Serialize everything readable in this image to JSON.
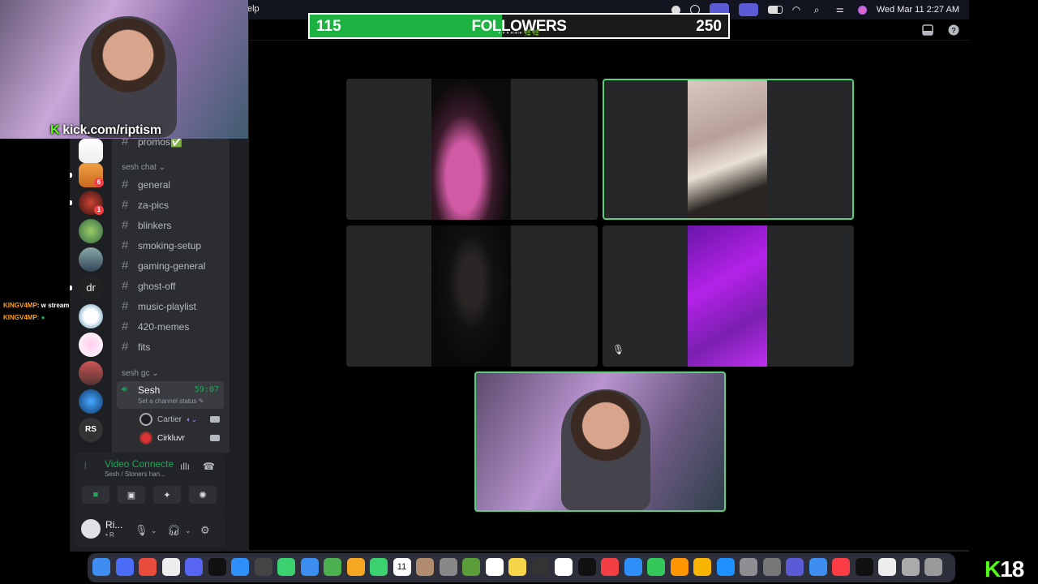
{
  "menubar": {
    "help": "elp",
    "datetime": "Wed Mar 11  2:27 AM"
  },
  "followers": {
    "current": "115",
    "label": "FOLLOWERS",
    "goal": "250",
    "ticker": "• • • •-•-• 🌿🌿",
    "progress": 0.46
  },
  "overlay": {
    "url": "kick.com/riptism",
    "brand_letter": "K",
    "age_badge": "18"
  },
  "chat": [
    {
      "name": "KINGV4MP",
      "message": ": w stream"
    },
    {
      "name": "KINGV4MP",
      "message": ": ●"
    }
  ],
  "rail": {
    "badges": [
      "6",
      "1"
    ],
    "text_server": "dr",
    "logo_server": "RS"
  },
  "channels": {
    "top_partial": "promos✅",
    "category1": "sesh chat ⌄",
    "list": [
      "general",
      "za-pics",
      "blinkers",
      "smoking-setup",
      "gaming-general",
      "ghost-off",
      "music-playlist",
      "420-memes",
      "fits"
    ],
    "category2": "sesh gc ⌄",
    "voice": {
      "name": "Sesh",
      "time": "59:07",
      "status": "Set a channel status ✎"
    },
    "voice_users": [
      {
        "name": "Cartier",
        "extra": "◐⌄"
      },
      {
        "name": "Cirkluvr",
        "extra": ""
      }
    ]
  },
  "voice_panel": {
    "title": "Video Connecte",
    "subtitle": "Sesh / Stoners han..."
  },
  "user_panel": {
    "name": "Ri...",
    "status": "• R"
  },
  "colors": {
    "accent_green": "#23a55a",
    "speaking": "#57d07a",
    "kick_green": "#53fc18",
    "followers_fill": "#1db342"
  },
  "dock_apps": [
    "finder-icon",
    "launchpad-icon",
    "chrome-icon",
    "apps-icon",
    "discord-icon",
    "tiktok-icon",
    "safari-icon",
    "obs-icon",
    "messages-icon",
    "mail-icon",
    "maps-icon",
    "photos-icon",
    "facetime-icon",
    "calendar-icon",
    "contacts-icon",
    "roblox-icon",
    "minecraft-icon",
    "reminders-icon",
    "notes-icon",
    "obs2-icon",
    "freeform-icon",
    "appletv-icon",
    "news-icon",
    "keynote-icon",
    "numbers-icon",
    "pages-icon",
    "pencil-icon",
    "appstore-icon",
    "settings-icon",
    "settings2-icon",
    "screentime-icon",
    "finder2-icon",
    "music-icon",
    "capcut-icon",
    "doc-icon",
    "folder-icon",
    "trash-icon"
  ],
  "calendar_day": "11"
}
